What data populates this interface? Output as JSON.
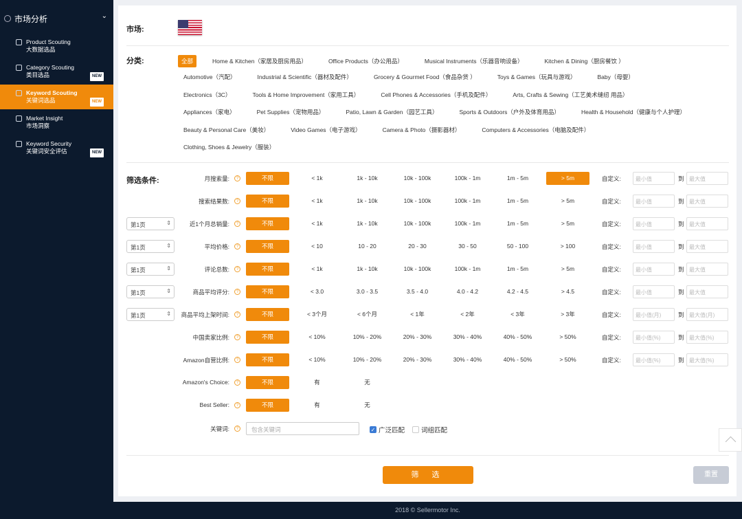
{
  "sidebar": {
    "section": "市场分析",
    "items": [
      {
        "en": "Product Scouting",
        "zh": "大数据选品",
        "badge": "",
        "active": false,
        "icon": "cloud-icon"
      },
      {
        "en": "Category Scouting",
        "zh": "类目选品",
        "badge": "NEW",
        "active": false,
        "icon": "grid-icon"
      },
      {
        "en": "Keyword Scouting",
        "zh": "关键词选品",
        "badge": "NEW",
        "active": true,
        "icon": "keyword-icon"
      },
      {
        "en": "Market Insight",
        "zh": "市场洞察",
        "badge": "",
        "active": false,
        "icon": "chart-icon"
      },
      {
        "en": "Keyword Security",
        "zh": "关键词安全评估",
        "badge": "NEW",
        "active": false,
        "icon": "shield-edit-icon"
      }
    ]
  },
  "market": {
    "label": "市场:",
    "flag": "us-flag"
  },
  "category": {
    "label": "分类:",
    "rows": [
      [
        "全部",
        "Home & Kitchen（家居及厨房用品）",
        "Office Products（办公用品）",
        "Musical Instruments（乐器音响设备）",
        "Kitchen & Dining（厨房餐饮 ）"
      ],
      [
        "Automotive（汽配）",
        "Industrial & Scientific（器材及配件）",
        "Grocery & Gourmet Food（食品杂货 ）",
        "Toys & Games（玩具与游戏）",
        "Baby（母婴）"
      ],
      [
        "Electronics（3C）",
        "Tools & Home Improvement（家用工具）",
        "Cell Phones & Accessories（手机及配件）",
        "Arts, Crafts & Sewing（工艺美术缝纫 用品）"
      ],
      [
        "Appliances（家电）",
        "Pet Supplies（宠物用品）",
        "Patio, Lawn & Garden（园艺工具）",
        "Sports & Outdoors（户外及体育用品）",
        "Health & Household（健康与个人护理）"
      ],
      [
        "Beauty & Personal Care（美妆）",
        "Video Games（电子游戏）",
        "Camera & Photo（摄影器材）",
        "Computers & Accessories（电脑及配件）"
      ],
      [
        "Clothing, Shoes & Jewelry（服装）"
      ]
    ],
    "selected": "全部"
  },
  "filters": {
    "label": "筛选条件:",
    "custom_label": "自定义:",
    "to_label": "到",
    "rows": [
      {
        "page": "",
        "label": "月搜索量:",
        "options": [
          "不限",
          "< 1k",
          "1k - 10k",
          "10k - 100k",
          "100k - 1m",
          "1m - 5m",
          "> 5m"
        ],
        "selected": [
          "不限",
          "> 5m"
        ],
        "min": "最小值",
        "max": "最大值"
      },
      {
        "page": "",
        "label": "搜索结果数:",
        "options": [
          "不限",
          "< 1k",
          "1k - 10k",
          "10k - 100k",
          "100k - 1m",
          "1m - 5m",
          "> 5m"
        ],
        "selected": [
          "不限"
        ],
        "min": "最小值",
        "max": "最大值"
      },
      {
        "page": "第1页",
        "label": "近1个月总销量:",
        "options": [
          "不限",
          "< 1k",
          "1k - 10k",
          "10k - 100k",
          "100k - 1m",
          "1m - 5m",
          "> 5m"
        ],
        "selected": [
          "不限"
        ],
        "min": "最小值",
        "max": "最大值"
      },
      {
        "page": "第1页",
        "label": "平均价格:",
        "options": [
          "不限",
          "< 10",
          "10 - 20",
          "20 - 30",
          "30 - 50",
          "50 - 100",
          "> 100"
        ],
        "selected": [
          "不限"
        ],
        "min": "最小值",
        "max": "最大值"
      },
      {
        "page": "第1页",
        "label": "评论总数:",
        "options": [
          "不限",
          "< 1k",
          "1k - 10k",
          "10k - 100k",
          "100k - 1m",
          "1m - 5m",
          "> 5m"
        ],
        "selected": [
          "不限"
        ],
        "min": "最小值",
        "max": "最大值"
      },
      {
        "page": "第1页",
        "label": "商品平均评分:",
        "options": [
          "不限",
          "< 3.0",
          "3.0 - 3.5",
          "3.5 - 4.0",
          "4.0 - 4.2",
          "4.2 - 4.5",
          "> 4.5"
        ],
        "selected": [
          "不限"
        ],
        "min": "最小值",
        "max": "最大值"
      },
      {
        "page": "第1页",
        "label": "商品平均上架时间:",
        "options": [
          "不限",
          "< 3个月",
          "< 6个月",
          "< 1年",
          "< 2年",
          "< 3年",
          "> 3年"
        ],
        "selected": [
          "不限"
        ],
        "min": "最小值(月)",
        "max": "最大值(月)"
      },
      {
        "page": "",
        "label": "中国卖家比例:",
        "options": [
          "不限",
          "< 10%",
          "10% - 20%",
          "20% - 30%",
          "30% - 40%",
          "40% - 50%",
          "> 50%"
        ],
        "selected": [
          "不限"
        ],
        "min": "最小值(%)",
        "max": "最大值(%)"
      },
      {
        "page": "",
        "label": "Amazon自营比例:",
        "options": [
          "不限",
          "< 10%",
          "10% - 20%",
          "20% - 30%",
          "30% - 40%",
          "40% - 50%",
          "> 50%"
        ],
        "selected": [
          "不限"
        ],
        "min": "最小值(%)",
        "max": "最大值(%)"
      },
      {
        "page": "",
        "label": "Amazon's Choice:",
        "options": [
          "不限",
          "有",
          "无"
        ],
        "selected": [
          "不限"
        ]
      },
      {
        "page": "",
        "label": "Best Seller:",
        "options": [
          "不限",
          "有",
          "无"
        ],
        "selected": [
          "不限"
        ]
      }
    ]
  },
  "keyword": {
    "label": "关键词:",
    "placeholder": "包含关键词",
    "broad": "广泛匹配",
    "broad_checked": true,
    "phrase": "词组匹配",
    "phrase_checked": false
  },
  "actions": {
    "filter": "筛 选",
    "reset": "重置"
  },
  "footer": "2018 © Sellermotor Inc.",
  "colors": {
    "accent": "#f08a0b",
    "sidebar": "#0c1a2d"
  }
}
